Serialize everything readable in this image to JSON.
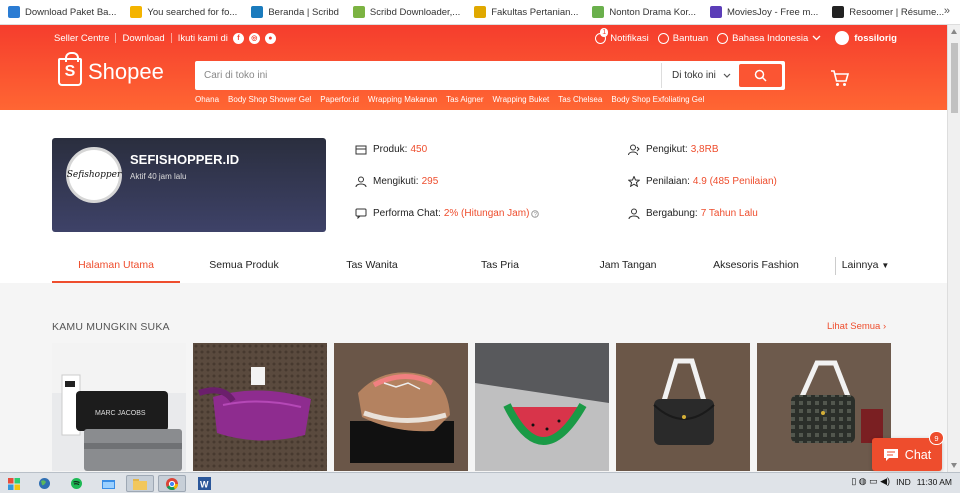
{
  "bookmarks": [
    {
      "label": "Download Paket Ba...",
      "color": "#2b7cd3"
    },
    {
      "label": "You searched for fo...",
      "color": "#f4b400"
    },
    {
      "label": "Beranda | Scribd",
      "color": "#1a7bbd"
    },
    {
      "label": "Scribd Downloader,...",
      "color": "#7cb342"
    },
    {
      "label": "Fakultas Pertanian...",
      "color": "#e0a800"
    },
    {
      "label": "Nonton Drama Kor...",
      "color": "#6ab04c"
    },
    {
      "label": "MoviesJoy - Free m...",
      "color": "#5b3db8"
    },
    {
      "label": "Resoomer | Résume...",
      "color": "#222222"
    }
  ],
  "bookmarks_more": "»",
  "topnav": {
    "seller": "Seller Centre",
    "download": "Download",
    "follow": "Ikuti kami di",
    "social": [
      {
        "icon": "facebook-icon",
        "glyph": "f"
      },
      {
        "icon": "instagram-icon",
        "glyph": "◎"
      },
      {
        "icon": "line-icon",
        "glyph": "●"
      }
    ],
    "notifications": "Notifikasi",
    "notif_count": "1",
    "help": "Bantuan",
    "language": "Bahasa Indonesia",
    "username": "fossilorig"
  },
  "logo": {
    "text": "Shopee",
    "bag_letter": "S"
  },
  "search": {
    "placeholder": "Cari di toko ini",
    "scope": "Di toko ini"
  },
  "suggestions": [
    "Ohana",
    "Body Shop Shower Gel",
    "Paperfor.id",
    "Wrapping Makanan",
    "Tas Aigner",
    "Wrapping Buket",
    "Tas Chelsea",
    "Body Shop Exfoliating Gel"
  ],
  "shop": {
    "name": "SEFISHOPPER.ID",
    "active": "Aktif 40 jam lalu",
    "avatar_text": "Sefishopper",
    "stats": {
      "products_label": "Produk:",
      "products_value": "450",
      "following_label": "Mengikuti:",
      "following_value": "295",
      "chat_label": "Performa Chat:",
      "chat_value": "2% (Hitungan Jam)",
      "followers_label": "Pengikut:",
      "followers_value": "3,8RB",
      "rating_label": "Penilaian:",
      "rating_value": "4.9 (485 Penilaian)",
      "joined_label": "Bergabung:",
      "joined_value": "7 Tahun Lalu"
    }
  },
  "tabs": [
    "Halaman Utama",
    "Semua Produk",
    "Tas Wanita",
    "Tas Pria",
    "Jam Tangan",
    "Aksesoris Fashion"
  ],
  "tab_more": "Lainnya",
  "section": {
    "title": "KAMU MUNGKIN SUKA",
    "see_all": "Lihat Semua"
  },
  "products": [
    {
      "name": "marc-jacobs-wallet",
      "brand_text": "MARC JACOBS"
    },
    {
      "name": "purple-waist-bag",
      "brand_text": ""
    },
    {
      "name": "coach-sneakers",
      "brand_text": ""
    },
    {
      "name": "kate-spade-watermelon-pouch",
      "brand_text": ""
    },
    {
      "name": "aigner-black-sling-bag",
      "brand_text": ""
    },
    {
      "name": "aigner-monogram-sling-bag",
      "brand_text": ""
    }
  ],
  "chat": {
    "label": "Chat",
    "badge": "9"
  },
  "taskbar": {
    "lang": "IND",
    "time": "11:30 AM"
  },
  "colors": {
    "brand": "#ee4d2d",
    "header_top": "#f53d2d",
    "header_bottom": "#ff6633"
  }
}
